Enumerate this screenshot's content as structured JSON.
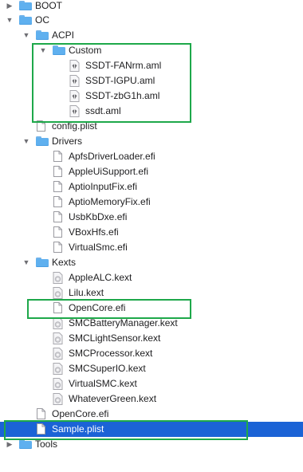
{
  "tree": {
    "items": [
      {
        "label": "BOOT",
        "type": "folder",
        "expanded": false
      },
      {
        "label": "OC",
        "type": "folder",
        "expanded": true
      },
      {
        "label": "ACPI",
        "type": "folder",
        "expanded": true
      },
      {
        "label": "Custom",
        "type": "folder",
        "expanded": true
      },
      {
        "label": "SSDT-FANrm.aml",
        "type": "aml"
      },
      {
        "label": "SSDT-IGPU.aml",
        "type": "aml"
      },
      {
        "label": "SSDT-zbG1h.aml",
        "type": "aml"
      },
      {
        "label": "ssdt.aml",
        "type": "aml"
      },
      {
        "label": "config.plist",
        "type": "file"
      },
      {
        "label": "Drivers",
        "type": "folder",
        "expanded": true
      },
      {
        "label": "ApfsDriverLoader.efi",
        "type": "file"
      },
      {
        "label": "AppleUiSupport.efi",
        "type": "file"
      },
      {
        "label": "AptioInputFix.efi",
        "type": "file"
      },
      {
        "label": "AptioMemoryFix.efi",
        "type": "file"
      },
      {
        "label": "UsbKbDxe.efi",
        "type": "file"
      },
      {
        "label": "VBoxHfs.efi",
        "type": "file"
      },
      {
        "label": "VirtualSmc.efi",
        "type": "file"
      },
      {
        "label": "Kexts",
        "type": "folder",
        "expanded": true
      },
      {
        "label": "AppleALC.kext",
        "type": "kext"
      },
      {
        "label": "Lilu.kext",
        "type": "kext"
      },
      {
        "label": "OpenCore.efi",
        "type": "file"
      },
      {
        "label": "SMCBatteryManager.kext",
        "type": "kext"
      },
      {
        "label": "SMCLightSensor.kext",
        "type": "kext"
      },
      {
        "label": "SMCProcessor.kext",
        "type": "kext"
      },
      {
        "label": "SMCSuperIO.kext",
        "type": "kext"
      },
      {
        "label": "VirtualSMC.kext",
        "type": "kext"
      },
      {
        "label": "WhateverGreen.kext",
        "type": "kext"
      },
      {
        "label": "OpenCore.efi",
        "type": "file"
      },
      {
        "label": "Sample.plist",
        "type": "file",
        "selected": true
      },
      {
        "label": "Tools",
        "type": "folder",
        "expanded": false
      }
    ]
  },
  "colors": {
    "selection": "#1b63d6",
    "highlight_box": "#1ea84a",
    "folder": "#5fb0ef"
  },
  "icons": {
    "folder": "folder-icon",
    "file": "document-icon",
    "kext": "kext-bundle-icon",
    "aml": "aml-script-icon",
    "expanded": "disclosure-triangle-down-icon",
    "collapsed": "disclosure-triangle-right-icon"
  }
}
